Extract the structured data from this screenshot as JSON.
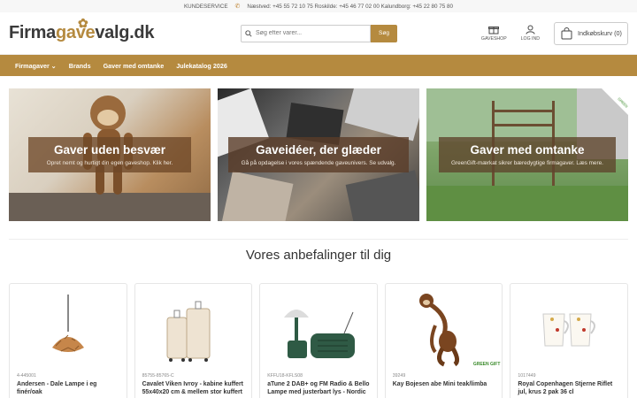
{
  "topbar": {
    "service": "KUNDESERVICE",
    "contacts": "Næstved: +45 55 72 10 75 Roskilde: +45 46 77 02 00 Kalundborg: +45 22 80 75 80"
  },
  "logo": {
    "part1": "Firma",
    "part2": "gave",
    "part3": "valg.dk"
  },
  "search": {
    "placeholder": "Søg efter varer...",
    "button": "Søg"
  },
  "header_icons": {
    "shop": "GAVESHOP",
    "login": "LOG IND",
    "cart": "Indkøbskurv (0)"
  },
  "nav": [
    "Firmagaver",
    "Brands",
    "Gaver med omtanke",
    "Julekatalog 2026"
  ],
  "banners": [
    {
      "title": "Gaver uden besvær",
      "subtitle": "Opret nemt og hurtigt din egen gaveshop.  Klik her."
    },
    {
      "title": "Gaveidéer, der glæder",
      "subtitle": "Gå på opdagelse i vores spændende gaveunivers. Se udvalg."
    },
    {
      "title": "Gaver med omtanke",
      "subtitle": "GreenGift-mærkat sikrer bæredygtige firmagaver. Læs mere."
    }
  ],
  "recommend_heading": "Vores anbefalinger til dig",
  "products": [
    {
      "sku": "4-445001",
      "name": "Andersen - Dale Lampe i eg finér/oak",
      "icon": "pendant-lamp-icon"
    },
    {
      "sku": "85755-85765-C",
      "name": "Cavalet Viken Ivroy - kabine kuffert 55x40x20 cm & mellem stor kuffert -",
      "icon": "suitcase-icon"
    },
    {
      "sku": "KFFU18-KFLS08",
      "name": "aTune 2 DAB+ og FM Radio & Bello Lampe med justerbart lys - Nordic",
      "icon": "radio-lamp-icon"
    },
    {
      "sku": "39249",
      "name": "Kay Bojesen abe Mini teak/limba",
      "icon": "wooden-monkey-icon"
    },
    {
      "sku": "1017449",
      "name": "Royal Copenhagen Stjerne Riflet jul, krus 2 pak 36 cl",
      "icon": "mugs-icon"
    }
  ],
  "badges": {
    "greengift": "GREEN GIFT"
  },
  "colors": {
    "accent": "#b58a3f",
    "text": "#333333"
  }
}
